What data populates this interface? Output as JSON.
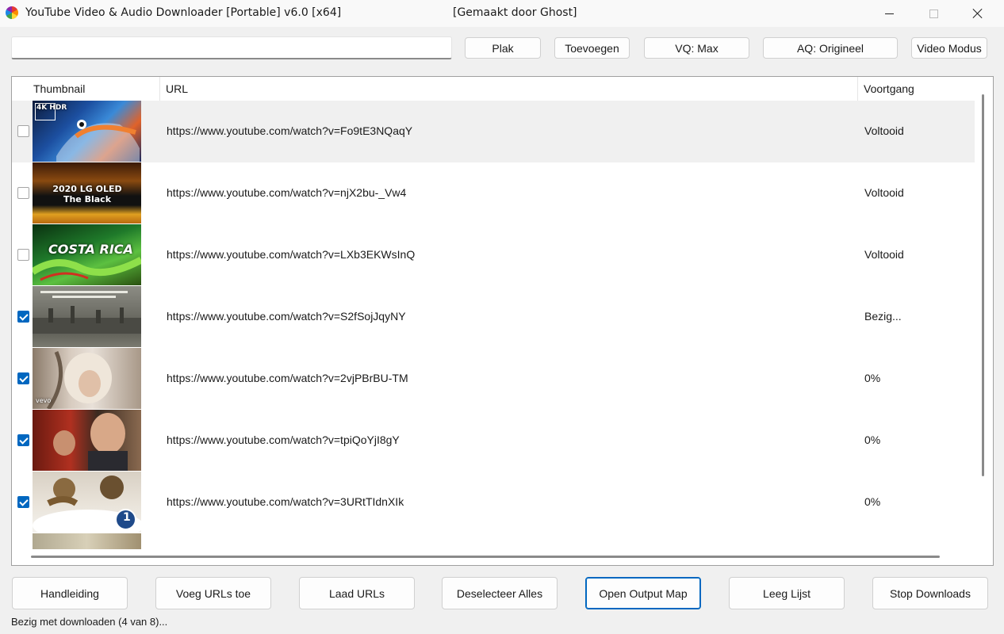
{
  "window": {
    "title": "YouTube Video & Audio Downloader [Portable] v6.0 [x64]",
    "credit": "[Gemaakt door Ghost]"
  },
  "toolbar": {
    "url_input_value": "",
    "paste_label": "Plak",
    "add_label": "Toevoegen",
    "vq_label": "VQ: Max",
    "aq_label": "AQ: Origineel",
    "mode_label": "Video Modus"
  },
  "list": {
    "columns": {
      "thumbnail": "Thumbnail",
      "url": "URL",
      "progress": "Voortgang"
    },
    "rows": [
      {
        "checked": false,
        "thumb_text": "4K HDR",
        "url": "https://www.youtube.com/watch?v=Fo9tE3NQaqY",
        "progress": "Voltooid"
      },
      {
        "checked": false,
        "thumb_text": "2020 LG OLED The Black",
        "url": "https://www.youtube.com/watch?v=njX2bu-_Vw4",
        "progress": "Voltooid"
      },
      {
        "checked": false,
        "thumb_text": "COSTA RICA",
        "url": "https://www.youtube.com/watch?v=LXb3EKWsInQ",
        "progress": "Voltooid"
      },
      {
        "checked": true,
        "thumb_text": "",
        "url": "https://www.youtube.com/watch?v=S2fSojJqyNY",
        "progress": "Bezig..."
      },
      {
        "checked": true,
        "thumb_text": "vevo",
        "url": "https://www.youtube.com/watch?v=2vjPBrBU-TM",
        "progress": "0%"
      },
      {
        "checked": true,
        "thumb_text": "",
        "url": "https://www.youtube.com/watch?v=tpiQoYjI8gY",
        "progress": "0%"
      },
      {
        "checked": true,
        "thumb_text": "1",
        "url": "https://www.youtube.com/watch?v=3URtTIdnXIk",
        "progress": "0%"
      }
    ]
  },
  "bottom": {
    "manual_label": "Handleiding",
    "add_urls_label": "Voeg URLs toe",
    "load_urls_label": "Laad URLs",
    "deselect_label": "Deselecteer Alles",
    "open_output_label": "Open Output Map",
    "clear_label": "Leeg Lijst",
    "stop_label": "Stop Downloads"
  },
  "status": "Bezig met downloaden (4 van 8)...",
  "colors": {
    "accent": "#0067c0",
    "background": "#f0f0f0",
    "selected_row": "#f0f0f0"
  }
}
